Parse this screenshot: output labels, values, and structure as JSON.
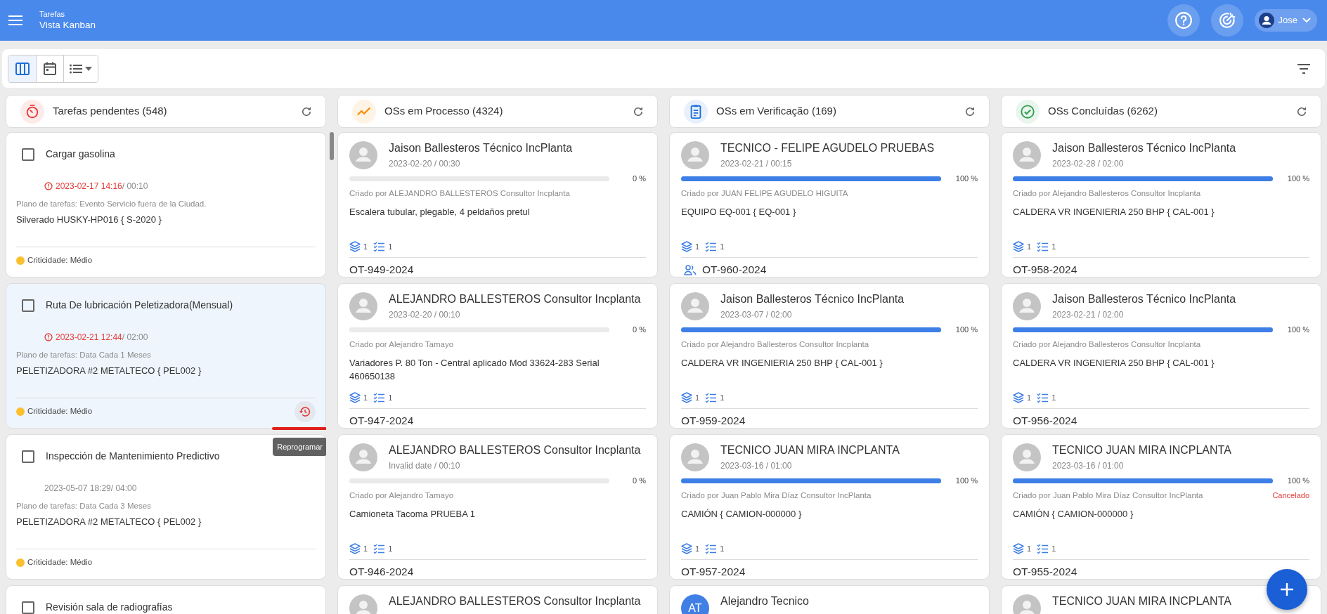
{
  "header": {
    "section": "Tarefas",
    "title": "Vista Kanban",
    "user": "Jose"
  },
  "toolbar": {
    "views": [
      {
        "kind": "kanban",
        "selected": true
      },
      {
        "kind": "calendar",
        "selected": false
      },
      {
        "kind": "list",
        "selected": false
      }
    ]
  },
  "columns": [
    {
      "kind": "tasks",
      "title": "Tarefas pendentes (548)",
      "color": "#e53935",
      "cards": [
        {
          "title": "Cargar gasolina",
          "checked": false,
          "overdue": true,
          "date": "2023-02-17 14:16",
          "duration": "/ 00:10",
          "plan": "Plano de tarefas: Evento Servicio fuera de la Ciudad.",
          "asset": "Silverado HUSKY-HP016 { S-2020 }",
          "criticality": "Criticidade: Médio",
          "color": "#fbc02d",
          "highlighted": false
        },
        {
          "title": "Ruta De lubricación Peletizadora(Mensual)",
          "checked": false,
          "overdue": true,
          "date": "2023-02-21 12:44",
          "duration": "/ 02:00",
          "plan": "Plano de tarefas: Data Cada 1 Meses",
          "asset": "PELETIZADORA #2 METALTECO { PEL002 }",
          "criticality": "Criticidade: Médio",
          "color": "#fbc02d",
          "highlighted": true,
          "reschedule_tooltip": "Reprogramar"
        },
        {
          "title": "Inspección de Mantenimiento Predictivo",
          "checked": false,
          "overdue": false,
          "date": "2023-05-07 18:29",
          "duration": "/ 04:00",
          "plan": "Plano de tarefas: Data Cada 3 Meses",
          "asset": "PELETIZADORA #2 METALTECO { PEL002 }",
          "criticality": "Criticidade: Médio",
          "color": "#fbc02d",
          "highlighted": false
        },
        {
          "title": "Revisión sala de radiografías",
          "checked": false,
          "highlighted": false
        }
      ]
    },
    {
      "kind": "process",
      "title": "OSs em Processo (4324)",
      "color": "#fb8c00",
      "cards": [
        {
          "assignee": "Jaison Ballesteros Técnico IncPlanta",
          "date": "2023-02-20 / 00:30",
          "level": 0,
          "percent": "0 %",
          "created_by": "Criado por ALEJANDRO BALLESTEROS Consultor Incplanta",
          "asset": "Escalera tubular, plegable, 4 peldaños pretul",
          "components": "1",
          "tasks": "1",
          "code": "OT-949-2024"
        },
        {
          "assignee": "ALEJANDRO BALLESTEROS Consultor Incplanta",
          "date": "2023-02-20 / 00:10",
          "level": 0,
          "percent": "0 %",
          "created_by": "Criado por Alejandro Tamayo",
          "asset": "Variadores P. 80 Ton - Central aplicado Mod 33624-283 Serial 460650138",
          "components": "1",
          "tasks": "1",
          "code": "OT-947-2024"
        },
        {
          "assignee": "ALEJANDRO BALLESTEROS Consultor Incplanta",
          "date": "Invalid date / 00:10",
          "level": 0,
          "percent": "0 %",
          "created_by": "Criado por Alejandro Tamayo",
          "asset": "Camioneta Tacoma PRUEBA 1",
          "components": "1",
          "tasks": "1",
          "code": "OT-946-2024"
        },
        {
          "assignee": "ALEJANDRO BALLESTEROS Consultor Incplanta"
        }
      ]
    },
    {
      "kind": "verification",
      "title": "OSs em Verificação (169)",
      "color": "#1e6fd9",
      "cards": [
        {
          "assignee": "TECNICO - FELIPE AGUDELO PRUEBAS",
          "date": "2023-02-21 / 00:15",
          "level": 1,
          "percent": "100 %",
          "created_by": "Criado por JUAN FELIPE AGUDELO HIGUITA",
          "asset": "EQUIPO EQ-001 { EQ-001 }",
          "components": "1",
          "tasks": "1",
          "code": "OT-960-2024",
          "team": true
        },
        {
          "assignee": "Jaison Ballesteros Técnico IncPlanta",
          "date": "2023-03-07 / 02:00",
          "level": 1,
          "percent": "100 %",
          "created_by": "Criado por Alejandro Ballesteros Consultor Incplanta",
          "asset": "CALDERA VR INGENIERIA 250 BHP { CAL-001 }",
          "components": "1",
          "tasks": "1",
          "code": "OT-959-2024"
        },
        {
          "assignee": "TECNICO JUAN MIRA INCPLANTA",
          "date": "2023-03-16 / 01:00",
          "level": 1,
          "percent": "100 %",
          "created_by": "Criado por Juan Pablo Mira Díaz Consultor IncPlanta",
          "asset": "CAMIÓN { CAMION-000000 }",
          "components": "1",
          "tasks": "1",
          "code": "OT-957-2024"
        },
        {
          "assignee": "Alejandro Tecnico",
          "initials": "AT"
        }
      ]
    },
    {
      "kind": "done",
      "title": "OSs Concluídas (6262)",
      "color": "#2e9d4f",
      "cards": [
        {
          "assignee": "Jaison Ballesteros Técnico IncPlanta",
          "date": "2023-02-28 / 02:00",
          "level": 1,
          "percent": "100 %",
          "created_by": "Criado por Alejandro Ballesteros Consultor Incplanta",
          "asset": "CALDERA VR INGENIERIA 250 BHP { CAL-001 }",
          "components": "1",
          "tasks": "1",
          "code": "OT-958-2024"
        },
        {
          "assignee": "Jaison Ballesteros Técnico IncPlanta",
          "date": "2023-02-21 / 02:00",
          "level": 1,
          "percent": "100 %",
          "created_by": "Criado por Alejandro Ballesteros Consultor Incplanta",
          "asset": "CALDERA VR INGENIERIA 250 BHP { CAL-001 }",
          "components": "1",
          "tasks": "1",
          "code": "OT-956-2024"
        },
        {
          "assignee": "TECNICO JUAN MIRA INCPLANTA",
          "date": "2023-03-16 / 01:00",
          "level": 1,
          "percent": "100 %",
          "created_by": "Criado por Juan Pablo Mira Díaz Consultor IncPlanta",
          "status": "Cancelado",
          "asset": "CAMIÓN { CAMION-000000 }",
          "components": "1",
          "tasks": "1",
          "code": "OT-955-2024"
        },
        {
          "assignee": "TECNICO JUAN MIRA INCPLANTA"
        }
      ]
    }
  ]
}
